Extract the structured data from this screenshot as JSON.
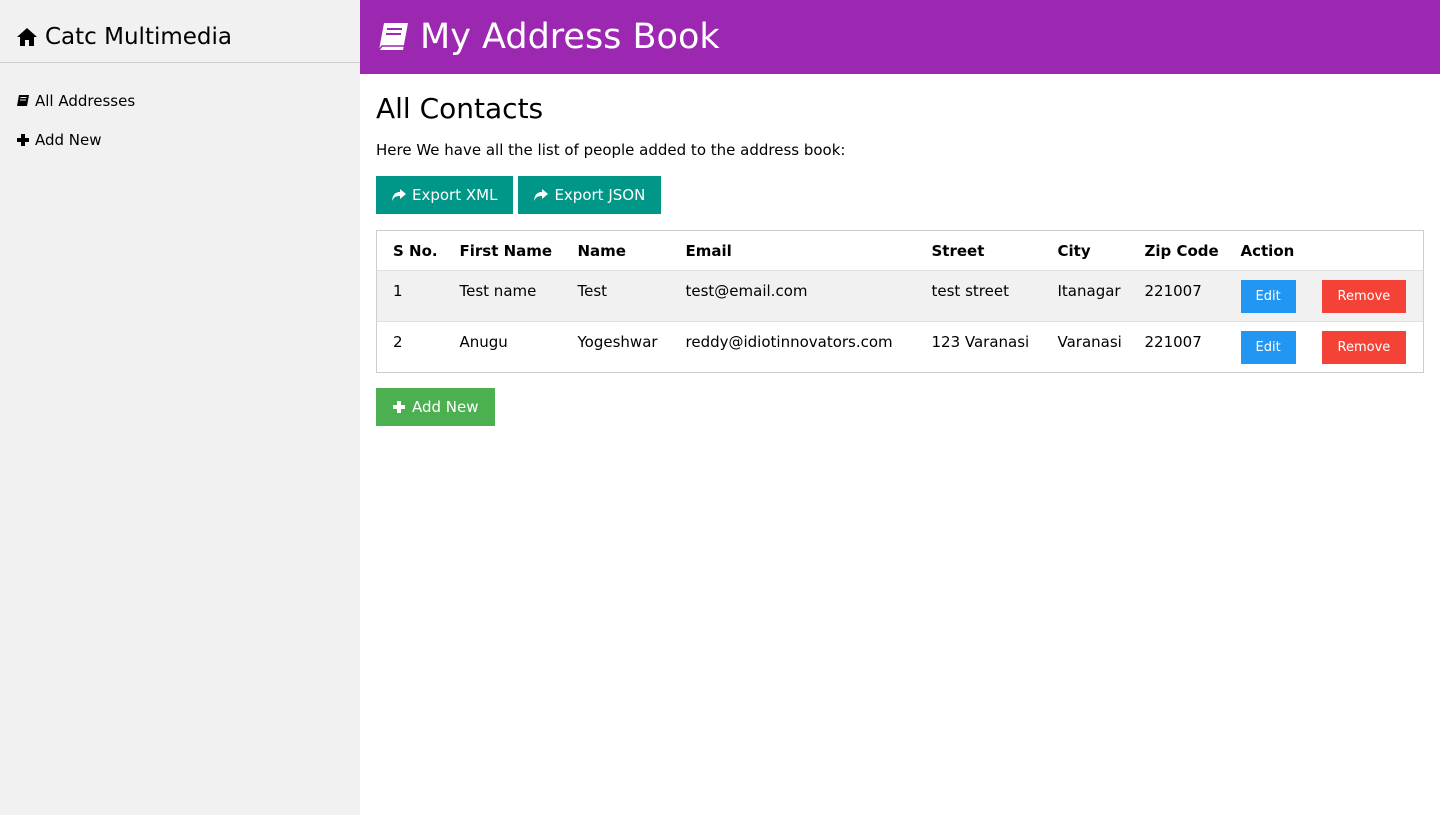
{
  "sidebar": {
    "brand": "Catc Multimedia",
    "items": [
      {
        "label": "All Addresses",
        "icon": "book-icon"
      },
      {
        "label": "Add New",
        "icon": "plus-icon"
      }
    ]
  },
  "header": {
    "title": "My Address Book",
    "icon": "book-icon"
  },
  "main": {
    "title": "All Contacts",
    "intro": "Here We have all the list of people added to the address book:",
    "export_xml": "Export XML",
    "export_json": "Export JSON",
    "add_new": "Add New"
  },
  "table": {
    "headers": [
      "S No.",
      "First Name",
      "Name",
      "Email",
      "Street",
      "City",
      "Zip Code",
      "Action"
    ],
    "rows": [
      {
        "sno": "1",
        "first_name": "Test name",
        "name": "Test",
        "email": "test@email.com",
        "street": "test street",
        "city": "Itanagar",
        "zip": "221007",
        "edit": "Edit",
        "remove": "Remove"
      },
      {
        "sno": "2",
        "first_name": "Anugu",
        "name": "Yogeshwar",
        "email": "reddy@idiotinnovators.com",
        "street": "123 Varanasi",
        "city": "Varanasi",
        "zip": "221007",
        "edit": "Edit",
        "remove": "Remove"
      }
    ]
  },
  "colors": {
    "header": "#9c27b0",
    "sidebar": "#f1f1f1",
    "export": "#009688",
    "edit": "#2196f3",
    "remove": "#f44336",
    "add": "#4caf50"
  }
}
